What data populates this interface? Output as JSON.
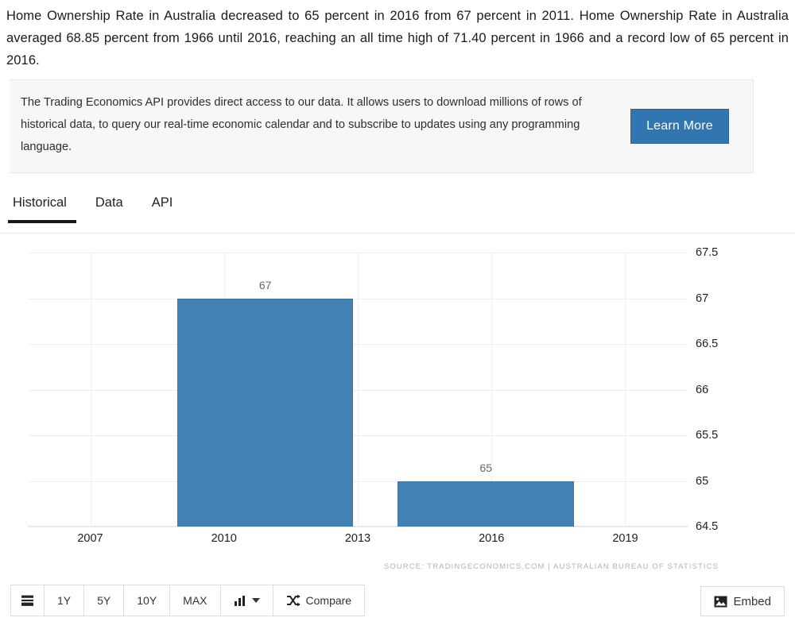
{
  "intro": {
    "paragraph": "Home Ownership Rate in Australia decreased to 65 percent in 2016 from 67 percent in 2011. Home Ownership Rate in Australia averaged 68.85 percent from 1966 until 2016, reaching an all time high of 71.40 percent in 1966 and a record low of 65 percent in 2016."
  },
  "api_box": {
    "text": "The Trading Economics API provides direct access to our data. It allows users to download millions of rows of historical data, to query our real-time economic calendar and to subscribe to updates using any programming language.",
    "button_label": "Learn More",
    "button_color": "#3276b1"
  },
  "tabs": [
    {
      "label": "Historical",
      "active": true
    },
    {
      "label": "Data",
      "active": false
    },
    {
      "label": "API",
      "active": false
    }
  ],
  "chart_data": {
    "type": "bar",
    "title": "",
    "xlabel": "",
    "ylabel": "",
    "categories": [
      "2011",
      "2016"
    ],
    "values": [
      67,
      65
    ],
    "data_labels": [
      "67",
      "65"
    ],
    "ylim": [
      64.5,
      67.5
    ],
    "yticks": [
      "67.5",
      "67",
      "66.5",
      "66",
      "65.5",
      "65",
      "64.5"
    ],
    "ytick_values": [
      67.5,
      67,
      66.5,
      66,
      65.5,
      65,
      64.5
    ],
    "xticks": [
      "2007",
      "2010",
      "2013",
      "2016",
      "2019"
    ],
    "xtick_values": [
      2007,
      2010,
      2013,
      2016,
      2019
    ],
    "grid": true,
    "legend": "none",
    "bar_color": "#4282b3",
    "source": "SOURCE: TRADINGECONOMICS.COM | AUSTRALIAN BUREAU OF STATISTICS"
  },
  "toolbar": {
    "list_icon": "list-icon",
    "ranges": [
      "1Y",
      "5Y",
      "10Y",
      "MAX"
    ],
    "chart_type_icon": "bar-chart-icon",
    "compare_label": "Compare",
    "compare_icon": "shuffle-icon",
    "embed_label": "Embed",
    "embed_icon": "image-icon"
  }
}
